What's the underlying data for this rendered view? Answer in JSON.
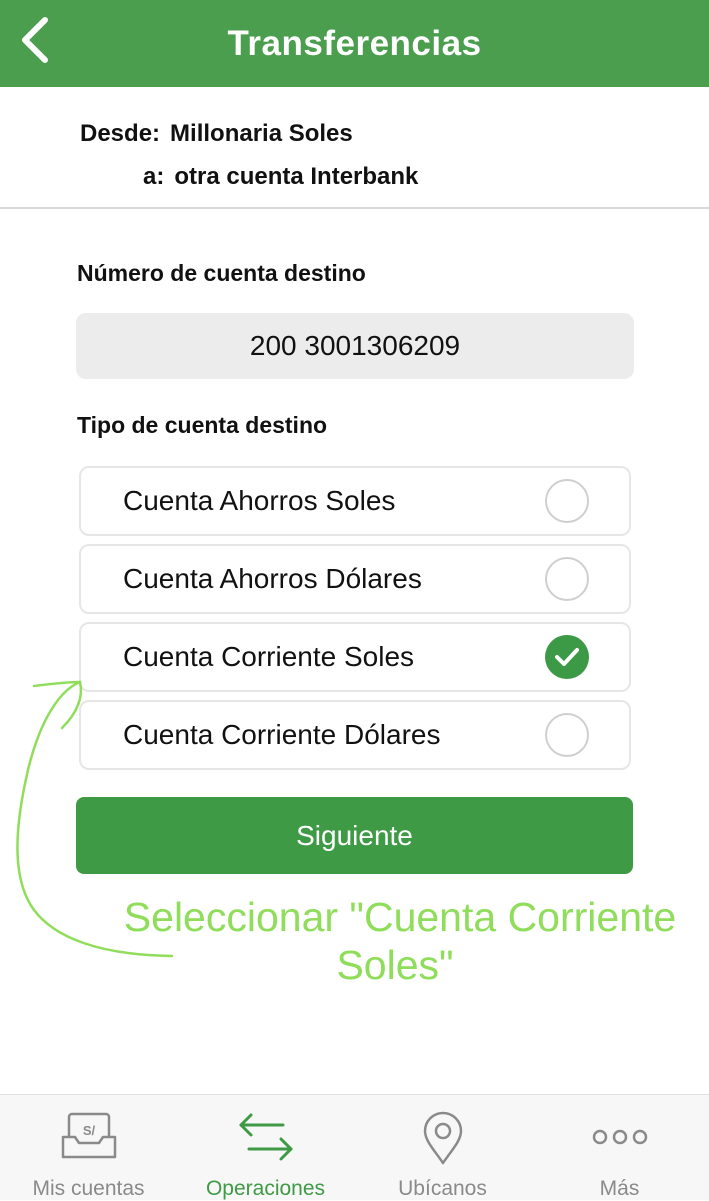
{
  "header": {
    "title": "Transferencias"
  },
  "transfer": {
    "from_label": "Desde:",
    "from_value": "Millonaria Soles",
    "to_label": "a:",
    "to_value": "otra cuenta Interbank"
  },
  "destination_account": {
    "label": "Número de cuenta destino",
    "value": "200 3001306209"
  },
  "account_type": {
    "label": "Tipo de cuenta destino",
    "options": [
      {
        "label": "Cuenta Ahorros Soles",
        "selected": false
      },
      {
        "label": "Cuenta Ahorros Dólares",
        "selected": false
      },
      {
        "label": "Cuenta Corriente Soles",
        "selected": true
      },
      {
        "label": "Cuenta Corriente Dólares",
        "selected": false
      }
    ]
  },
  "next_button": {
    "label": "Siguiente"
  },
  "annotation": {
    "line1": "Seleccionar \"Cuenta Corriente",
    "line2": "Soles\""
  },
  "tabbar": {
    "items": [
      {
        "label": "Mis cuentas",
        "icon": "wallet-soles-icon",
        "active": false
      },
      {
        "label": "Operaciones",
        "icon": "transfer-arrows-icon",
        "active": true
      },
      {
        "label": "Ubícanos",
        "icon": "location-pin-icon",
        "active": false
      },
      {
        "label": "Más",
        "icon": "more-dots-icon",
        "active": false
      }
    ]
  },
  "colors": {
    "brand_green": "#4a9e4e",
    "button_green": "#3f9a46",
    "annotation_green": "#8fdd5a"
  }
}
